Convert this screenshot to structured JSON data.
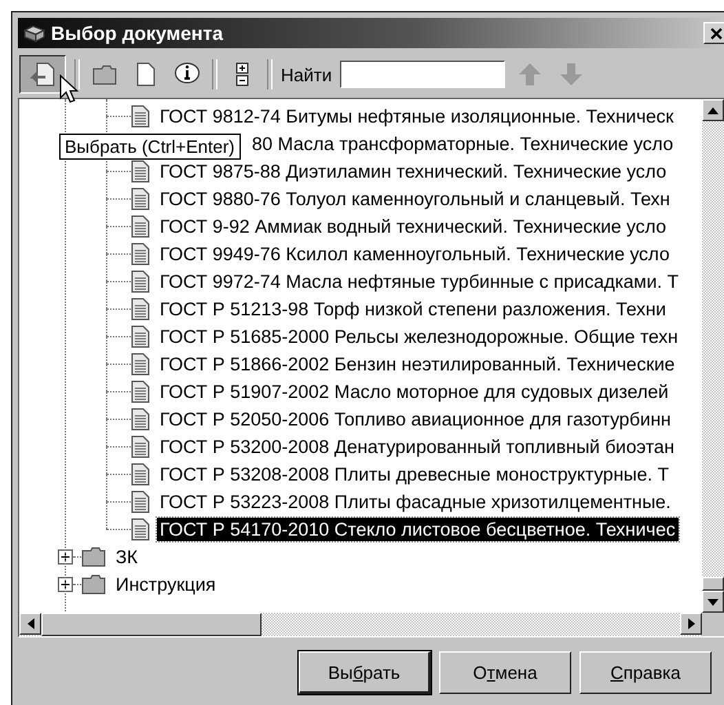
{
  "window": {
    "title": "Выбор документа"
  },
  "toolbar": {
    "select_pressed": true,
    "tooltip": "Выбрать (Ctrl+Enter)",
    "find_label": "Найти",
    "up_disabled": true,
    "down_disabled": true
  },
  "tree": {
    "documents": [
      {
        "label": "ГОСТ 9812-74 Битумы нефтяные изоляционные. Техническ",
        "kind": "plain",
        "selected": false
      },
      {
        "label": "80 Масла трансформаторные. Технические усло",
        "kind": "covered",
        "selected": false
      },
      {
        "label": "ГОСТ 9875-88 Диэтиламин технический. Технические усло",
        "kind": "plain",
        "selected": false
      },
      {
        "label": "ГОСТ 9880-76 Толуол каменноугольный и сланцевый. Техн",
        "kind": "plain",
        "selected": false
      },
      {
        "label": "ГОСТ 9-92 Аммиак водный  технический. Технические усло",
        "kind": "plain",
        "selected": false
      },
      {
        "label": "ГОСТ 9949-76 Ксилол каменноугольный. Технические усло",
        "kind": "plain",
        "selected": false
      },
      {
        "label": "ГОСТ 9972-74 Масла нефтяные турбинные с присадками. Т",
        "kind": "plain",
        "selected": false
      },
      {
        "label": "ГОСТ Р 51213-98 Торф низкой степени разложения. Техни",
        "kind": "plain",
        "selected": false
      },
      {
        "label": "ГОСТ Р 51685-2000 Рельсы железнодорожные. Общие техн",
        "kind": "plain",
        "selected": false
      },
      {
        "label": "ГОСТ Р 51866-2002 Бензин неэтилированный. Технические",
        "kind": "plain",
        "selected": false
      },
      {
        "label": "ГОСТ Р 51907-2002 Масло моторное для судовых дизелей",
        "kind": "plain",
        "selected": false
      },
      {
        "label": "ГОСТ Р 52050-2006 Топливо авиационное для газотурбинн",
        "kind": "plain",
        "selected": false
      },
      {
        "label": "ГОСТ Р 53200-2008 Денатурированный топливный биоэтан",
        "kind": "plain",
        "selected": false
      },
      {
        "label": "ГОСТ Р 53208-2008 Плиты древесные моноструктурные. Т",
        "kind": "plain",
        "selected": false
      },
      {
        "label": "ГОСТ Р 53223-2008 Плиты фасадные хризотилцементные.",
        "kind": "plain",
        "selected": false
      },
      {
        "label": "ГОСТ Р 54170-2010 Стекло листовое бесцветное. Техничес",
        "kind": "plain",
        "selected": true
      }
    ],
    "folders": [
      {
        "label": "ЗК",
        "expanded": false
      },
      {
        "label": "Инструкция",
        "expanded": false
      }
    ]
  },
  "buttons": [
    {
      "before": "Вы",
      "key": "б",
      "after": "рать",
      "default": true
    },
    {
      "before": "О",
      "key": "т",
      "after": "мена",
      "default": false
    },
    {
      "key": "С",
      "after": "правка",
      "default": false
    }
  ]
}
